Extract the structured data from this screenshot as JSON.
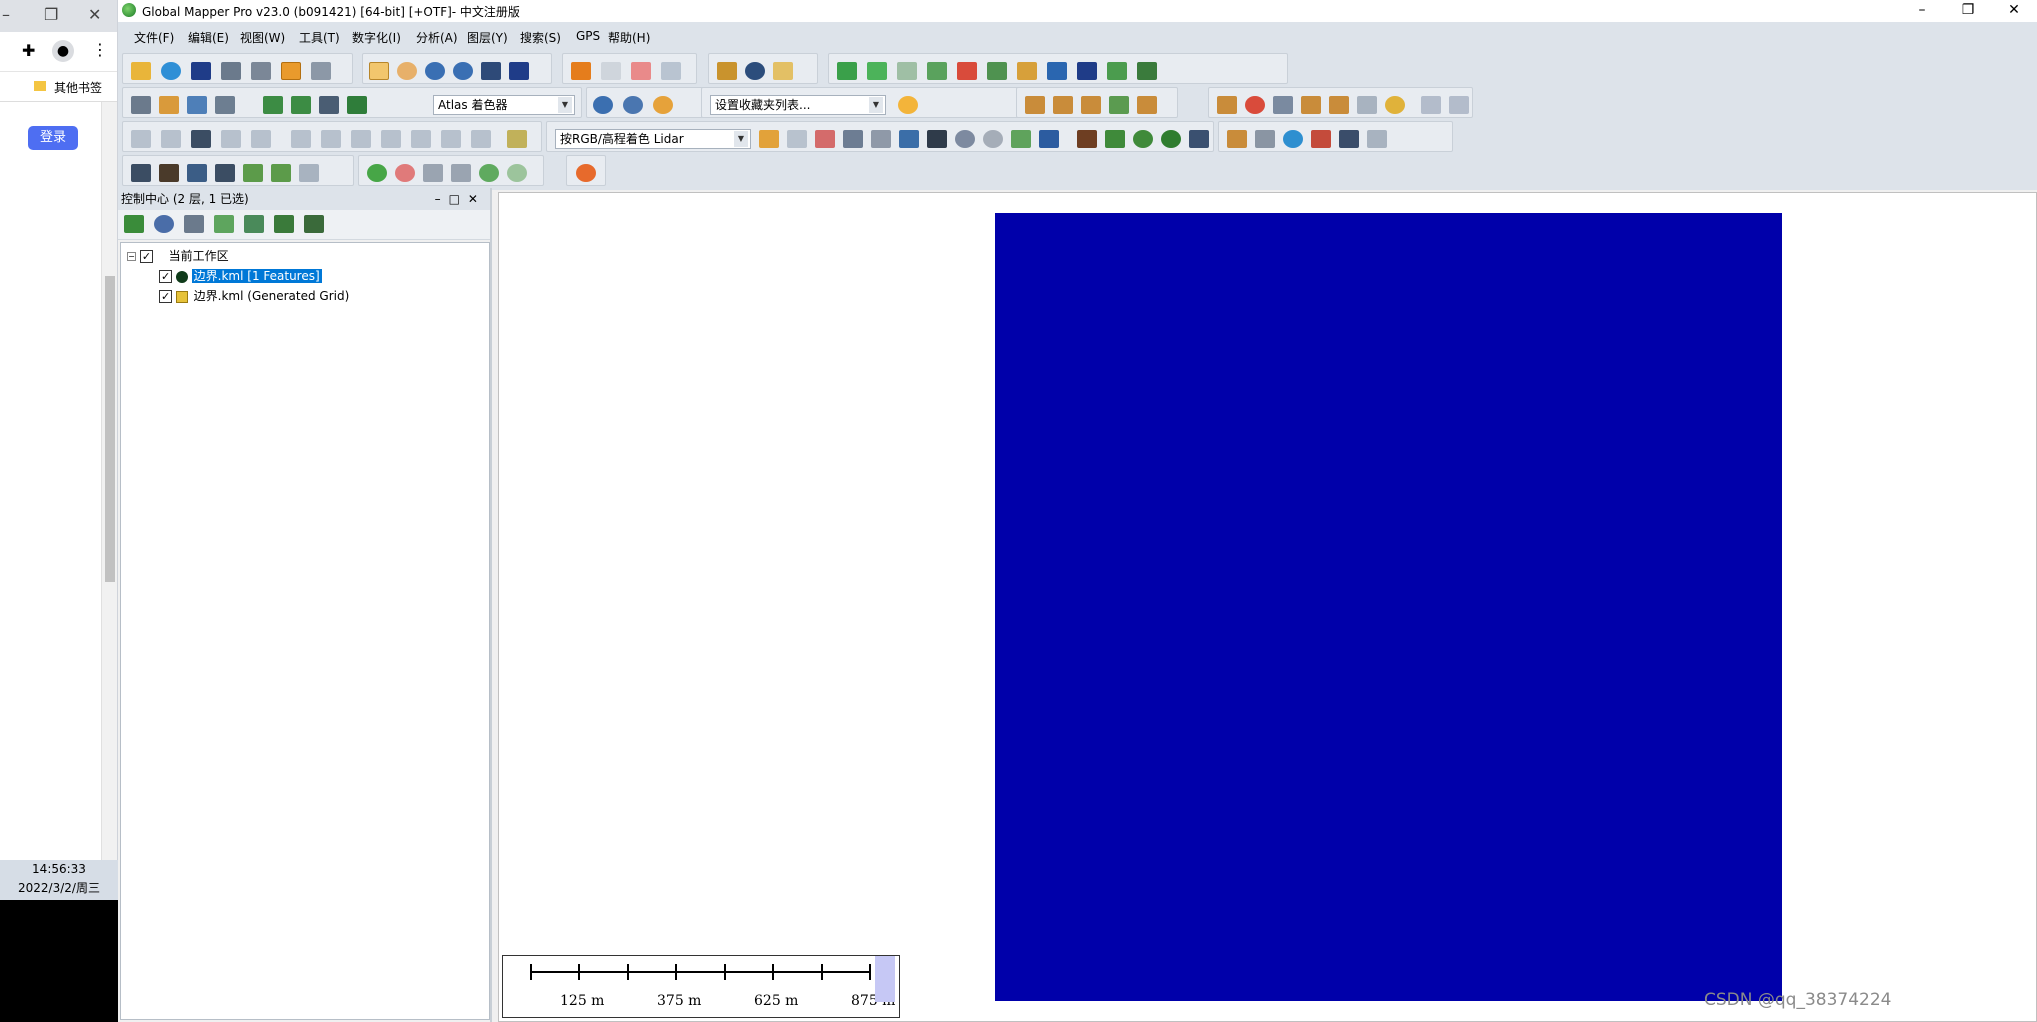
{
  "browser": {
    "bookmark_label": "其他书签",
    "login_label": "登录",
    "clock_time": "14:56:33",
    "clock_date": "2022/3/2/周三"
  },
  "window": {
    "title": "Global Mapper Pro v23.0 (b091421) [64-bit] [+OTF]- 中文注册版"
  },
  "menu": [
    "文件(F)",
    "编辑(E)",
    "视图(W)",
    "工具(T)",
    "数字化(I)",
    "分析(A)",
    "图层(Y)",
    "搜索(S)",
    "GPS",
    "帮助(H)"
  ],
  "toolbars": {
    "shader_combo": "Atlas 着色器",
    "favorites_combo": "设置收藏夹列表...",
    "lidar_combo": "按RGB/高程着色 Lidar"
  },
  "control_center": {
    "title": "控制中心 (2 层, 1 已选)",
    "workspace_label": "当前工作区",
    "layers": [
      {
        "name": "边界.kml [1 Features]",
        "selected": true,
        "checked": true
      },
      {
        "name": "边界.kml (Generated Grid)",
        "selected": false,
        "checked": true
      }
    ]
  },
  "map": {
    "raster_color": "#0000aa",
    "scale_labels": [
      "125 m",
      "375 m",
      "625 m",
      "875 m"
    ]
  },
  "watermark": "CSDN @qq_38374224"
}
